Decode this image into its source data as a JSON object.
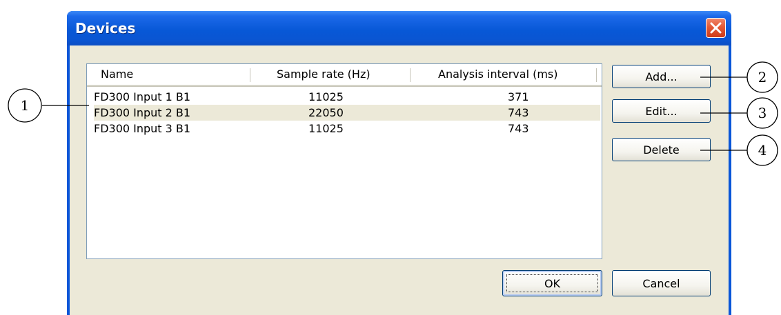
{
  "window": {
    "title": "Devices"
  },
  "list": {
    "columns": [
      "Name",
      "Sample rate (Hz)",
      "Analysis interval (ms)"
    ],
    "rows": [
      [
        "FD300 Input 1 B1",
        "11025",
        "371"
      ],
      [
        "FD300 Input 2 B1",
        "22050",
        "743"
      ],
      [
        "FD300 Input 3 B1",
        "11025",
        "743"
      ]
    ]
  },
  "buttons": {
    "add": "Add...",
    "edit": "Edit...",
    "delete": "Delete",
    "ok": "OK",
    "cancel": "Cancel"
  },
  "callouts": [
    "1",
    "2",
    "3",
    "4"
  ],
  "icons": {
    "close": "close-x-icon"
  },
  "colors": {
    "titlebar": "#0a56d8",
    "dialog_face": "#ece9d8",
    "close_button": "#e35a36",
    "alt_row": "#ece9d8"
  }
}
